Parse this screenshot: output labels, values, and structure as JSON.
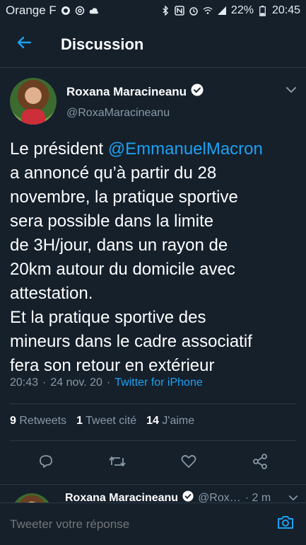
{
  "status_bar": {
    "carrier": "Orange F",
    "battery": "22%",
    "time": "20:45",
    "icons_left": [
      "whatsapp-icon",
      "at-icon",
      "cloud-icon"
    ],
    "icons_right": [
      "bluetooth-icon",
      "nfc-icon",
      "alarm-icon",
      "wifi-icon",
      "signal-icon",
      "battery-icon"
    ]
  },
  "app_bar": {
    "title": "Discussion",
    "back_icon": "arrow-left-icon"
  },
  "tweet": {
    "author_name": "Roxana Maracineanu",
    "author_handle": "@RoxaMaracineanu",
    "verified": true,
    "text_prefix": "Le président ",
    "mention": "@EmmanuelMacron",
    "text_suffix": "\na annoncé qu’à partir du 28\nnovembre, la pratique sportive\nsera possible dans la limite\nde 3H/jour, dans un rayon de\n20km autour du domicile avec\nattestation.\nEt la pratique sportive des\nmineurs dans le cadre associatif\nfera son retour en extérieur",
    "time": "20:43",
    "date": "24 nov. 20",
    "separator": "·",
    "source": "Twitter for iPhone",
    "retweets_count": "9",
    "retweets_label": "Retweets",
    "quotes_count": "1",
    "quotes_label": "Tweet cité",
    "likes_count": "14",
    "likes_label": "J'aime"
  },
  "reply_preview": {
    "name": "Roxana Maracineanu",
    "handle": "@Rox…",
    "time": "· 2 m"
  },
  "composer": {
    "placeholder": "Tweeter votre réponse"
  },
  "colors": {
    "background": "#15202b",
    "accent": "#1da1f2",
    "muted": "#8899a6",
    "divider": "#2a3844"
  }
}
